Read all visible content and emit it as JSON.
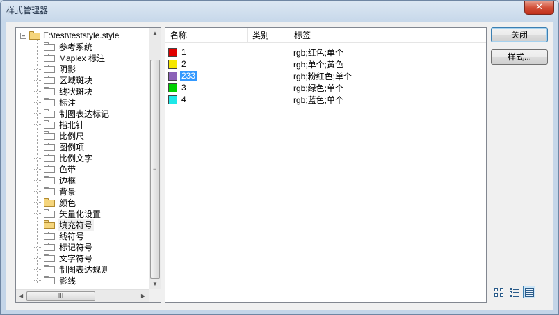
{
  "window": {
    "title": "样式管理器",
    "close_glyph": "✕"
  },
  "tree": {
    "root": "E:\\test\\teststyle.style",
    "items": [
      {
        "label": "参考系统",
        "folder": "plain"
      },
      {
        "label": "Maplex 标注",
        "folder": "plain"
      },
      {
        "label": "阴影",
        "folder": "plain"
      },
      {
        "label": "区域斑块",
        "folder": "plain"
      },
      {
        "label": "线状斑块",
        "folder": "plain"
      },
      {
        "label": "标注",
        "folder": "plain"
      },
      {
        "label": "制图表达标记",
        "folder": "plain"
      },
      {
        "label": "指北针",
        "folder": "plain"
      },
      {
        "label": "比例尺",
        "folder": "plain"
      },
      {
        "label": "图例项",
        "folder": "plain"
      },
      {
        "label": "比例文字",
        "folder": "plain"
      },
      {
        "label": "色带",
        "folder": "plain"
      },
      {
        "label": "边框",
        "folder": "plain"
      },
      {
        "label": "背景",
        "folder": "plain"
      },
      {
        "label": "颜色",
        "folder": "yellow"
      },
      {
        "label": "矢量化设置",
        "folder": "plain"
      },
      {
        "label": "填充符号",
        "folder": "yellow-open",
        "selected": true
      },
      {
        "label": "线符号",
        "folder": "plain"
      },
      {
        "label": "标记符号",
        "folder": "plain"
      },
      {
        "label": "文字符号",
        "folder": "plain"
      },
      {
        "label": "制图表达规则",
        "folder": "plain"
      },
      {
        "label": "影线",
        "folder": "plain"
      }
    ],
    "hscroll_grip": "III",
    "vscroll_grip": "≡"
  },
  "list": {
    "columns": [
      "名称",
      "类别",
      "标签"
    ],
    "rows": [
      {
        "name": "1",
        "category": "",
        "tag": "rgb;红色;单个",
        "color": "#e00000"
      },
      {
        "name": "2",
        "category": "",
        "tag": "rgb;单个;黄色",
        "color": "#f5e600"
      },
      {
        "name": "233",
        "category": "",
        "tag": "rgb;粉红色;单个",
        "color": "#8c62b8",
        "selected": true
      },
      {
        "name": "3",
        "category": "",
        "tag": "rgb;绿色;单个",
        "color": "#00d000"
      },
      {
        "name": "4",
        "category": "",
        "tag": "rgb;蓝色;单个",
        "color": "#1ee8e8"
      }
    ]
  },
  "buttons": {
    "close": "关闭",
    "styles": "样式..."
  },
  "view_modes": [
    {
      "name": "large-icons-view",
      "active": false
    },
    {
      "name": "list-view",
      "active": false
    },
    {
      "name": "details-view",
      "active": true
    }
  ]
}
